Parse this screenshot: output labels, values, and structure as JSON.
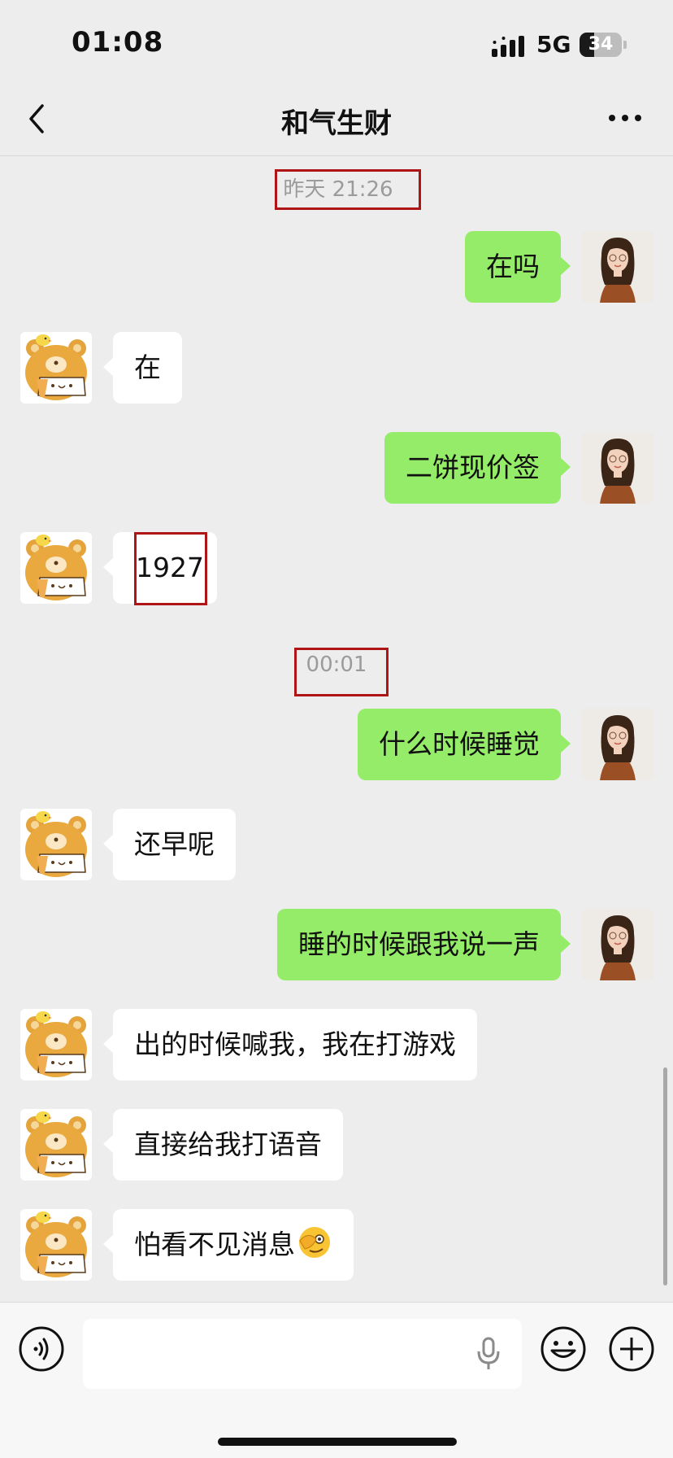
{
  "status_bar": {
    "time": "01:08",
    "network": "5G",
    "battery": "34",
    "battery_level": 0.34
  },
  "header": {
    "title": "和气生财"
  },
  "messages": [
    {
      "type": "timestamp",
      "text": "昨天 21:26",
      "highlighted": true
    },
    {
      "type": "out",
      "text": "在吗"
    },
    {
      "type": "in",
      "text": "在"
    },
    {
      "type": "out",
      "text": "二饼现价签"
    },
    {
      "type": "in",
      "text": "1927",
      "highlighted": true
    },
    {
      "type": "timestamp",
      "text": "00:01",
      "highlighted": true
    },
    {
      "type": "out",
      "text": "什么时候睡觉"
    },
    {
      "type": "in",
      "text": "还早呢"
    },
    {
      "type": "out",
      "text": "睡的时候跟我说一声"
    },
    {
      "type": "in",
      "text": "出的时候喊我，我在打游戏"
    },
    {
      "type": "in",
      "text": "直接给我打语音"
    },
    {
      "type": "in",
      "text": "怕看不见消息",
      "emoji": "peeking-face-emoji"
    }
  ],
  "icons": {
    "back": "chevron-left-icon",
    "more": "more-dots-icon",
    "voice": "voice-mode-icon",
    "mic": "microphone-icon",
    "emoji": "smiley-face-icon",
    "plus": "plus-circle-icon"
  },
  "colors": {
    "background": "#ededed",
    "outgoing_bubble": "#95ec69",
    "incoming_bubble": "#ffffff",
    "highlight_border": "#b01515",
    "timestamp_text": "#9b9b9b"
  }
}
